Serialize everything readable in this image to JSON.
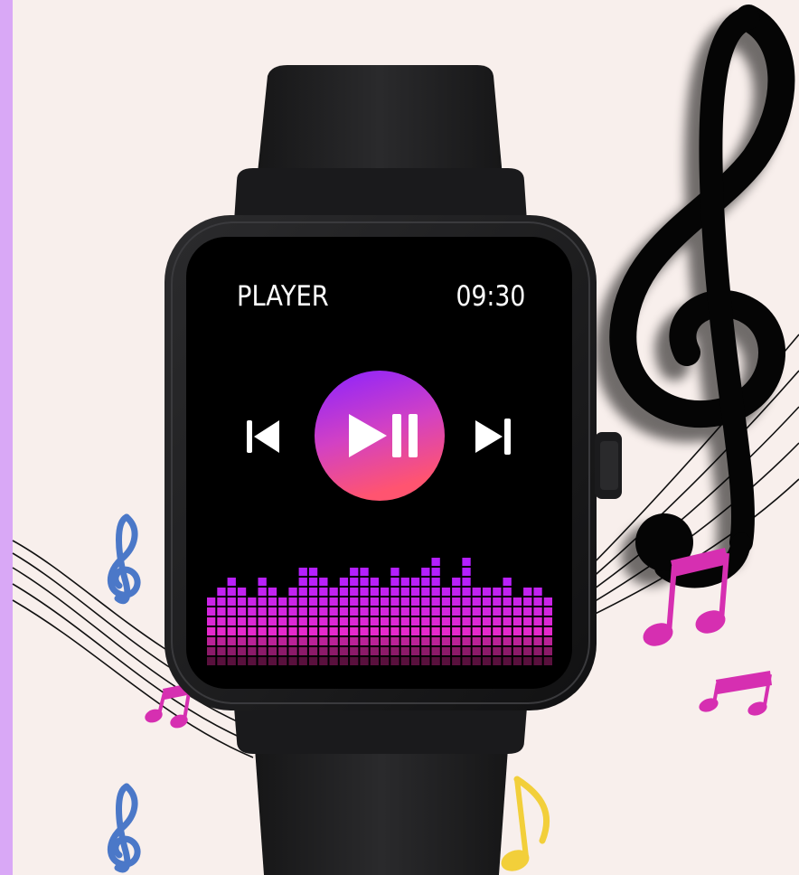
{
  "screen": {
    "title": "PLAYER",
    "time": "09:30"
  },
  "controls": {
    "prev_icon": "skip-previous-icon",
    "play_pause_icon": "play-pause-icon",
    "next_icon": "skip-next-icon"
  },
  "equalizer": {
    "icon": "audio-spectrum-visualizer",
    "levels": [
      7,
      8,
      9,
      8,
      7,
      9,
      8,
      7,
      8,
      10,
      10,
      9,
      8,
      9,
      10,
      10,
      9,
      8,
      10,
      9,
      9,
      10,
      11,
      8,
      9,
      11,
      8,
      8,
      8,
      9,
      7,
      8,
      8,
      7
    ]
  },
  "decorations": {
    "treble_clef": "treble-clef-icon",
    "notes": [
      "blue-treble-clef-icon",
      "pink-beamed-notes-icon",
      "yellow-eighth-note-icon"
    ]
  },
  "colors": {
    "background": "#f8efec",
    "left_strip": "#d9a8f6",
    "screen": "#000000",
    "watch_body": "#1b1b1d",
    "play_gradient_top": "#8a22ff",
    "play_gradient_bottom": "#ff5470",
    "equalizer_top": "#b41fff",
    "equalizer_bottom": "#ff2fb0"
  }
}
